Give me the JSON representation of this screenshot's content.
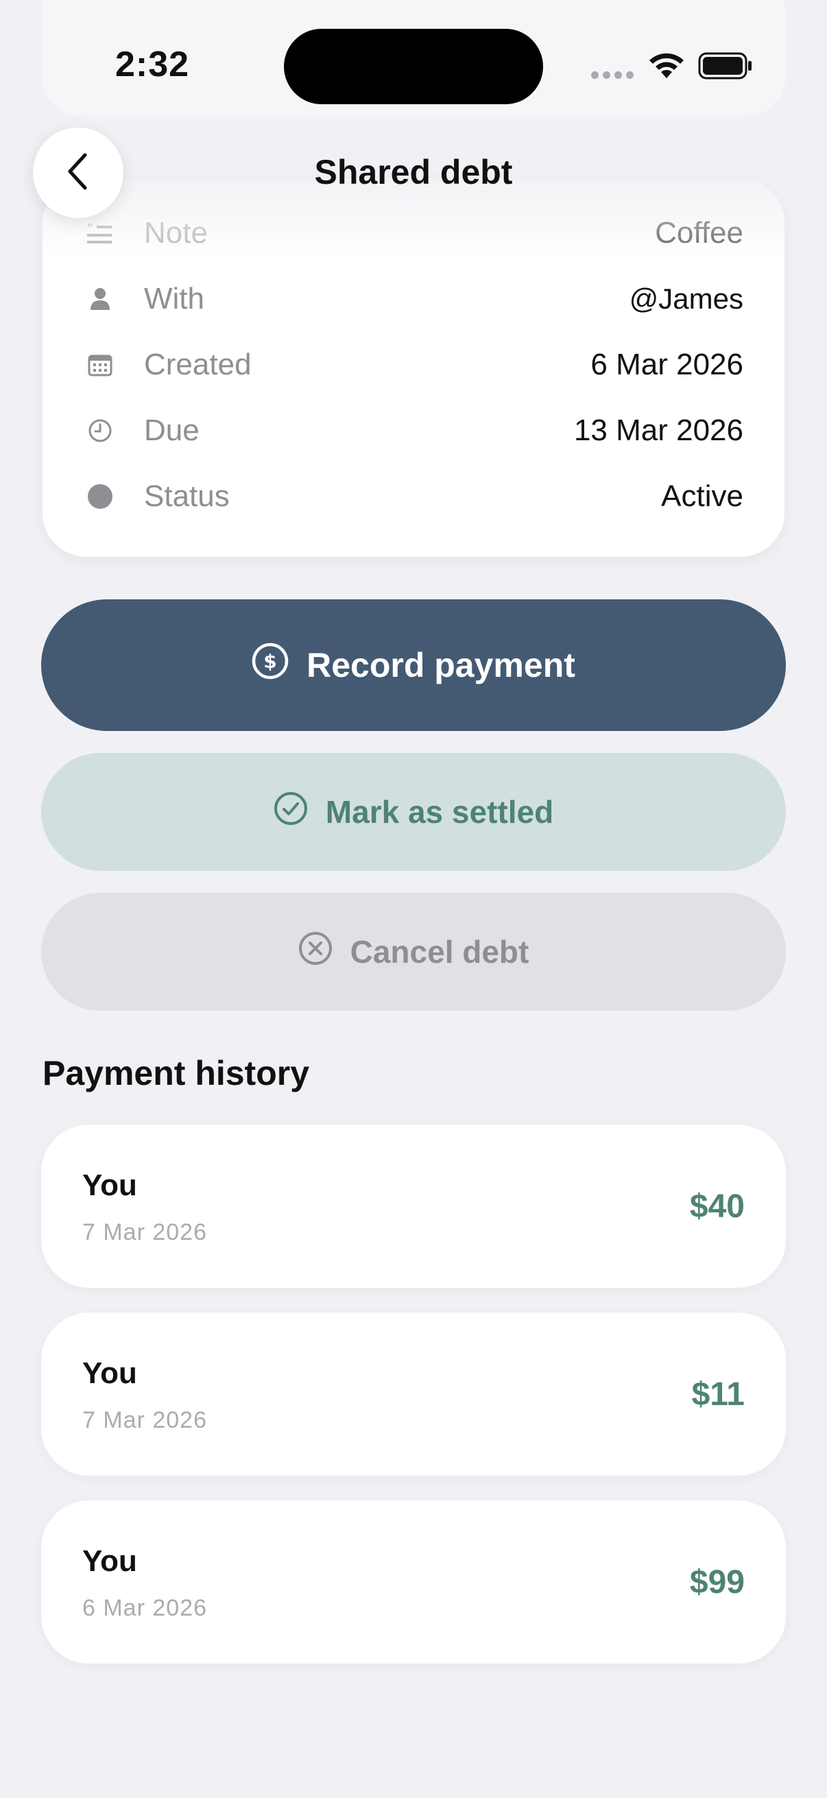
{
  "status_bar": {
    "time": "2:32",
    "icons": [
      "cellular-dots-icon",
      "wifi-icon",
      "battery-icon"
    ]
  },
  "header": {
    "title": "Shared debt",
    "back_icon": "chevron-left-icon"
  },
  "details": [
    {
      "icon": "quote-icon",
      "label": "Note",
      "value": "Coffee"
    },
    {
      "icon": "person-icon",
      "label": "With",
      "value": "@James"
    },
    {
      "icon": "calendar-icon",
      "label": "Created",
      "value": "6 Mar 2026"
    },
    {
      "icon": "clock-icon",
      "label": "Due",
      "value": "13 Mar 2026"
    },
    {
      "icon": "status-dot-icon",
      "label": "Status",
      "value": "Active"
    }
  ],
  "actions": {
    "record_payment": {
      "label": "Record payment",
      "icon": "dollar-circle-icon"
    },
    "mark_settled": {
      "label": "Mark as settled",
      "icon": "check-circle-icon"
    },
    "cancel_debt": {
      "label": "Cancel debt",
      "icon": "x-circle-icon"
    }
  },
  "payment_history": {
    "title": "Payment history",
    "items": [
      {
        "who": "You",
        "date": "7 Mar 2026",
        "amount": "$40"
      },
      {
        "who": "You",
        "date": "7 Mar 2026",
        "amount": "$11"
      },
      {
        "who": "You",
        "date": "6 Mar 2026",
        "amount": "$99"
      }
    ]
  },
  "colors": {
    "primary": "#445a73",
    "settle_bg": "#d2dfdf",
    "accent_green": "#4e8374",
    "cancel_bg": "#e0e0e5",
    "muted": "#8e8e93",
    "background": "#f1f1f5"
  }
}
